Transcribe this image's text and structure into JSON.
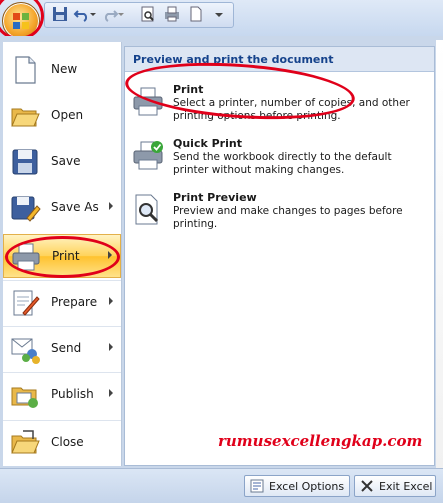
{
  "left_menu": {
    "items": [
      {
        "label": "New",
        "has_submenu": false,
        "icon": "new-document-icon"
      },
      {
        "label": "Open",
        "has_submenu": false,
        "icon": "open-folder-icon"
      },
      {
        "label": "Save",
        "has_submenu": false,
        "icon": "save-disk-icon"
      },
      {
        "label": "Save As",
        "has_submenu": true,
        "icon": "save-as-icon"
      },
      {
        "label": "Print",
        "has_submenu": true,
        "active": true,
        "icon": "printer-icon"
      },
      {
        "label": "Prepare",
        "has_submenu": true,
        "icon": "prepare-icon"
      },
      {
        "label": "Send",
        "has_submenu": true,
        "icon": "send-icon"
      },
      {
        "label": "Publish",
        "has_submenu": true,
        "icon": "publish-icon"
      },
      {
        "label": "Close",
        "has_submenu": false,
        "icon": "close-folder-icon"
      }
    ]
  },
  "right_panel": {
    "title": "Preview and print the document",
    "options": [
      {
        "title": "Print",
        "description": "Select a printer, number of copies, and other printing options before printing.",
        "icon": "printer-icon"
      },
      {
        "title": "Quick Print",
        "description": "Send the workbook directly to the default printer without making changes.",
        "icon": "quick-print-icon"
      },
      {
        "title": "Print Preview",
        "description": "Preview and make changes to pages before printing.",
        "icon": "print-preview-icon"
      }
    ]
  },
  "watermark": "rumusexcellengkap.com",
  "bottom": {
    "options_label": "Excel Options",
    "exit_label": "Exit Excel"
  },
  "colors": {
    "accent": "#15428b",
    "highlight": "#ffd35b",
    "annotation": "#e0001a"
  }
}
